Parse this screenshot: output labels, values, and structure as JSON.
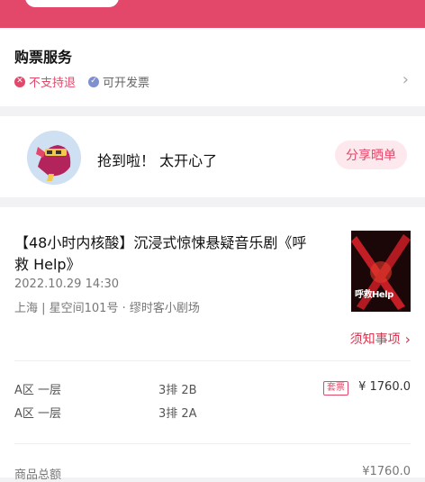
{
  "service": {
    "title": "购票服务",
    "tags": [
      {
        "icon": "cross-circle-icon",
        "label": "不支持退"
      },
      {
        "icon": "check-circle-icon",
        "label": "可开发票"
      }
    ]
  },
  "share": {
    "avatar_icon": "mascot-avatar",
    "message": "抢到啦！ 太开心了",
    "button": "分享晒单"
  },
  "show": {
    "title": "【48小时内核酸】沉浸式惊悚悬疑音乐剧《呼救 Help》",
    "datetime": "2022.10.29 14:30",
    "venue": "上海 | 星空间101号 · 缪时客小剧场",
    "poster_text": "呼救Help",
    "notice": "须知事项"
  },
  "tickets": [
    {
      "area": "A区 一层",
      "seat": "3排 2B",
      "badge": "套票",
      "price": "¥ 1760.0"
    },
    {
      "area": "A区 一层",
      "seat": "3排 2A",
      "badge": "",
      "price": ""
    }
  ],
  "total": {
    "label": "商品总额",
    "value": "¥1760.0"
  },
  "colors": {
    "brand": "#e3476a",
    "link": "#d9344f"
  }
}
